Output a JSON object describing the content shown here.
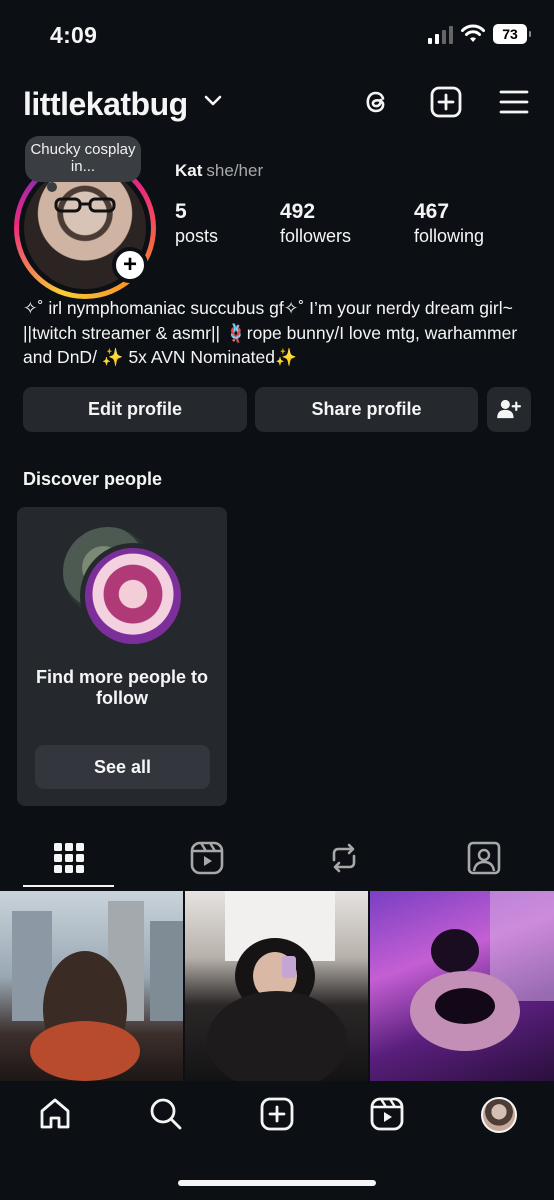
{
  "status_bar": {
    "time": "4:09",
    "battery": "73"
  },
  "header": {
    "username": "littlekatbug"
  },
  "profile": {
    "note": "Chucky cosplay in...",
    "name": "Kat",
    "pronouns": "she/her",
    "stats": {
      "posts": {
        "value": "5",
        "label": "posts"
      },
      "followers": {
        "value": "492",
        "label": "followers"
      },
      "following": {
        "value": "467",
        "label": "following"
      }
    },
    "bio": "✧˚ irl nymphomaniac succubus gf✧˚  I’m your nerdy dream girl~ ||twitch streamer & asmr|| 🪢rope bunny/I love mtg, warhammer and DnD/ ✨ 5x AVN Nominated✨"
  },
  "actions": {
    "edit_profile": "Edit profile",
    "share_profile": "Share profile"
  },
  "discover": {
    "title": "Discover people",
    "card_text": "Find more people to follow",
    "see_all": "See all"
  },
  "tabs": [
    "grid-icon",
    "reels-icon",
    "reposts-icon",
    "tagged-icon"
  ],
  "bottom_nav": [
    "home-icon",
    "search-icon",
    "create-icon",
    "reels-icon",
    "profile-avatar"
  ],
  "colors": {
    "background": "#0c1014",
    "button": "#25292e",
    "text": "#f5f5f5",
    "muted": "#a8a8a8"
  }
}
